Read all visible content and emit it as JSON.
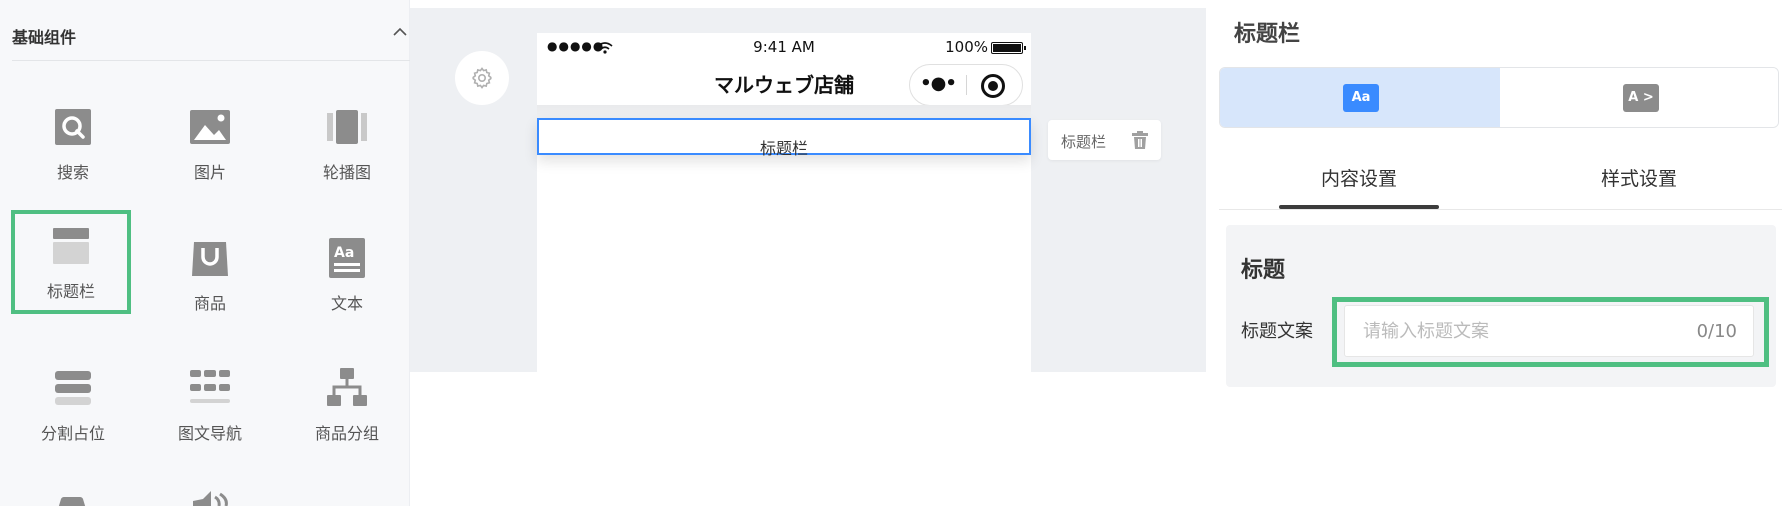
{
  "sidebar": {
    "title": "基础组件",
    "components": [
      {
        "label": "搜索",
        "icon": "search-icon"
      },
      {
        "label": "图片",
        "icon": "image-icon"
      },
      {
        "label": "轮播图",
        "icon": "carousel-icon"
      },
      {
        "label": "标题栏",
        "icon": "title-bar-icon",
        "selected": true
      },
      {
        "label": "商品",
        "icon": "shopping-bag-icon"
      },
      {
        "label": "文本",
        "icon": "text-icon"
      },
      {
        "label": "分割占位",
        "icon": "divider-icon"
      },
      {
        "label": "图文导航",
        "icon": "image-text-nav-icon"
      },
      {
        "label": "商品分组",
        "icon": "product-group-icon"
      }
    ]
  },
  "phone": {
    "status": {
      "signal": "●●●●●",
      "time": "9:41 AM",
      "battery": "100%"
    },
    "nav_title": "マルウェブ店舗",
    "capsule_more": "•●•",
    "title_block_text": "标题栏"
  },
  "block_tag": {
    "label": "标题栏"
  },
  "panel": {
    "title": "标题栏",
    "style_options": [
      {
        "label": "Aa",
        "icon": "text-style-icon",
        "active": true
      },
      {
        "label": "A >",
        "icon": "text-arrow-style-icon",
        "active": false
      }
    ],
    "tabs": [
      {
        "label": "内容设置",
        "active": true
      },
      {
        "label": "样式设置",
        "active": false
      }
    ],
    "form": {
      "heading": "标题",
      "field_label": "标题文案",
      "field_value": "",
      "field_placeholder": "请输入标题文案",
      "counter": "0/10"
    }
  },
  "colors": {
    "accent_blue": "#3a8bff",
    "selected_green": "#4fbf82",
    "icon_gray": "#8c8c8c",
    "active_segment_bg": "#d7e6fb"
  }
}
